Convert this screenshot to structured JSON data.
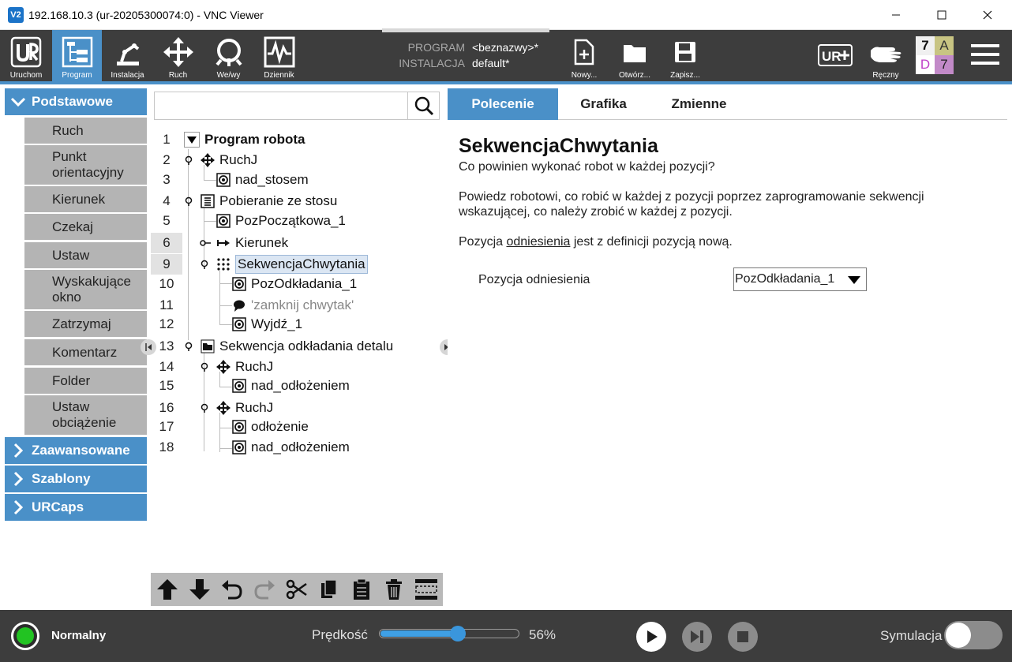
{
  "window": {
    "title": "192.168.10.3 (ur-20205300074:0) - VNC Viewer",
    "app_icon": "V2",
    "minimize_icon": "minimize-icon",
    "maximize_icon": "maximize-icon",
    "close_icon": "close-icon"
  },
  "toolbar": {
    "nav": [
      {
        "label": "Uruchom",
        "icon": "ur-logo-icon"
      },
      {
        "label": "Program",
        "icon": "program-tree-icon"
      },
      {
        "label": "Instalacja",
        "icon": "robot-arm-icon"
      },
      {
        "label": "Ruch",
        "icon": "move-arrows-icon"
      },
      {
        "label": "We/wy",
        "icon": "io-icon"
      },
      {
        "label": "Dziennik",
        "icon": "log-icon"
      }
    ],
    "program_label": "PROGRAM",
    "installation_label": "INSTALACJA",
    "program_value": "<beznazwy>*",
    "installation_value": "default*",
    "file_actions": [
      {
        "label": "Nowy...",
        "icon": "new-file-icon"
      },
      {
        "label": "Otwórz...",
        "icon": "open-folder-icon"
      },
      {
        "label": "Zapisz...",
        "icon": "save-icon"
      }
    ],
    "urplus_icon": "ur-plus-icon",
    "manual_label": "Ręczny",
    "status_grid": [
      "7",
      "A",
      "D",
      "7"
    ],
    "status_colors": {
      "seven_bg": "#f0f0f0",
      "a_bg": "#c8c483",
      "d_bg": "#c28ac8",
      "seven2_bg": "#c28ac8"
    },
    "menu_icon": "hamburger-menu-icon"
  },
  "sidebar": {
    "categories": {
      "basic": "Podstawowe",
      "advanced": "Zaawansowane",
      "templates": "Szablony",
      "urcaps": "URCaps"
    },
    "items": [
      "Ruch",
      "Punkt orientacyjny",
      "Kierunek",
      "Czekaj",
      "Ustaw",
      "Wyskakujące okno",
      "Zatrzymaj",
      "Komentarz",
      "Folder",
      "Ustaw obciążenie"
    ]
  },
  "tree": {
    "search_placeholder": "",
    "rows": [
      {
        "n": "1",
        "label": "Program robota",
        "icon": "collapse-triangle-icon"
      },
      {
        "n": "2",
        "label": "RuchJ",
        "icon": "move-arrows-icon"
      },
      {
        "n": "3",
        "label": "nad_stosem",
        "icon": "waypoint-icon"
      },
      {
        "n": "4",
        "label": "Pobieranie ze stosu",
        "icon": "stack-icon"
      },
      {
        "n": "5",
        "label": "PozPoczątkowa_1",
        "icon": "waypoint-icon"
      },
      {
        "n": "6",
        "label": "Kierunek",
        "icon": "direction-arrow-icon"
      },
      {
        "n": "9",
        "label": "SekwencjaChwytania",
        "icon": "pattern-grid-icon"
      },
      {
        "n": "10",
        "label": "PozOdkładania_1",
        "icon": "waypoint-icon"
      },
      {
        "n": "11",
        "label": "'zamknij chwytak'",
        "icon": "comment-bubble-icon"
      },
      {
        "n": "12",
        "label": "Wyjdź_1",
        "icon": "waypoint-icon"
      },
      {
        "n": "13",
        "label": "Sekwencja odkładania detalu",
        "icon": "folder-icon"
      },
      {
        "n": "14",
        "label": "RuchJ",
        "icon": "move-arrows-icon"
      },
      {
        "n": "15",
        "label": "nad_odłożeniem",
        "icon": "waypoint-icon"
      },
      {
        "n": "16",
        "label": "RuchJ",
        "icon": "move-arrows-icon"
      },
      {
        "n": "17",
        "label": "odłożenie",
        "icon": "waypoint-icon"
      },
      {
        "n": "18",
        "label": "nad_odłożeniem",
        "icon": "waypoint-icon"
      }
    ],
    "tools": [
      "move-up-icon",
      "move-down-icon",
      "undo-icon",
      "redo-icon",
      "cut-icon",
      "copy-icon",
      "paste-icon",
      "delete-icon",
      "suppress-icon"
    ]
  },
  "panel": {
    "tabs": [
      "Polecenie",
      "Grafika",
      "Zmienne"
    ],
    "heading": "SekwencjaChwytania",
    "subtitle": "Co powinien wykonać robot w każdej pozycji?",
    "description": "Powiedz robotowi, co robić w każdej z pozycji poprzez zaprogramowanie sekwencji wskazującej, co należy zrobić w każdej z pozycji.",
    "ref_text_before": "Pozycja ",
    "ref_text_link": "odniesienia",
    "ref_text_after": " jest z definicji pozycją nową.",
    "ref_label": "Pozycja odniesienia",
    "ref_value": "PozOdkładania_1"
  },
  "status": {
    "mode": "Normalny",
    "speed_label": "Prędkość",
    "speed_percent": "56%",
    "speed_fraction": 0.56,
    "sim_label": "Symulacja",
    "play_icon": "play-icon",
    "step_icon": "step-icon",
    "stop_icon": "stop-icon",
    "status_color": "#22c322"
  }
}
